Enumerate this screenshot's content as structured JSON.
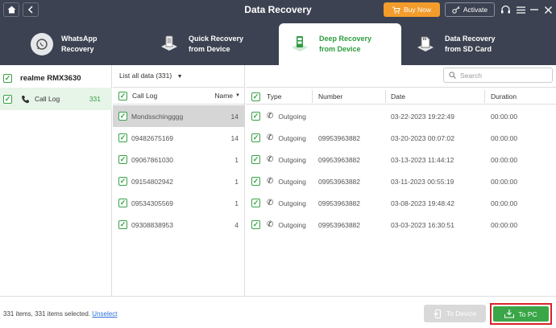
{
  "titlebar": {
    "title": "Data Recovery",
    "home_icon": "home-icon",
    "back_icon": "back-icon",
    "buy_now": "Buy Now",
    "activate": "Activate"
  },
  "tabs": [
    {
      "line1": "WhatsApp",
      "line2": "Recovery",
      "icon": "whatsapp-icon",
      "active": false
    },
    {
      "line1": "Quick Recovery",
      "line2": "from Device",
      "icon": "device-icon",
      "active": false
    },
    {
      "line1": "Deep Recovery",
      "line2": "from Device",
      "icon": "deep-scan-icon",
      "active": true
    },
    {
      "line1": "Data Recovery",
      "line2": "from SD Card",
      "icon": "sd-card-icon",
      "active": false
    }
  ],
  "sidebar": {
    "device_name": "realme RMX3630",
    "items": [
      {
        "label": "Call Log",
        "count": "331"
      }
    ]
  },
  "middle": {
    "filter_label": "List all data (331)",
    "header_label": "Call Log",
    "sort_label": "Name",
    "rows": [
      {
        "name": "Mondsschingggg",
        "count": "14"
      },
      {
        "name": "09482675169",
        "count": "14"
      },
      {
        "name": "09067861030",
        "count": "1"
      },
      {
        "name": "09154802942",
        "count": "1"
      },
      {
        "name": "09534305569",
        "count": "1"
      },
      {
        "name": "09308838953",
        "count": "4"
      }
    ]
  },
  "search": {
    "placeholder": "Search"
  },
  "table": {
    "headers": {
      "type": "Type",
      "number": "Number",
      "date": "Date",
      "duration": "Duration"
    },
    "rows": [
      {
        "type": "Outgoing",
        "number": "",
        "date": "03-22-2023 19:22:49",
        "duration": "00:00:00"
      },
      {
        "type": "Outgoing",
        "number": "09953963882",
        "date": "03-20-2023 00:07:02",
        "duration": "00:00:00"
      },
      {
        "type": "Outgoing",
        "number": "09953963882",
        "date": "03-13-2023 11:44:12",
        "duration": "00:00:00"
      },
      {
        "type": "Outgoing",
        "number": "09953963882",
        "date": "03-11-2023 00:55:19",
        "duration": "00:00:00"
      },
      {
        "type": "Outgoing",
        "number": "09953963882",
        "date": "03-08-2023 19:48:42",
        "duration": "00:00:00"
      },
      {
        "type": "Outgoing",
        "number": "09953963882",
        "date": "03-03-2023 16:30:51",
        "duration": "00:00:00"
      }
    ]
  },
  "footer": {
    "status": "331 items, 331 items selected.",
    "unselect": "Unselect",
    "to_device": "To Device",
    "to_pc": "To PC"
  },
  "colors": {
    "titlebar_bg": "#3c4251",
    "accent_green": "#3aa648",
    "buy_orange": "#f39c2c",
    "highlight_red": "#d8232a"
  }
}
